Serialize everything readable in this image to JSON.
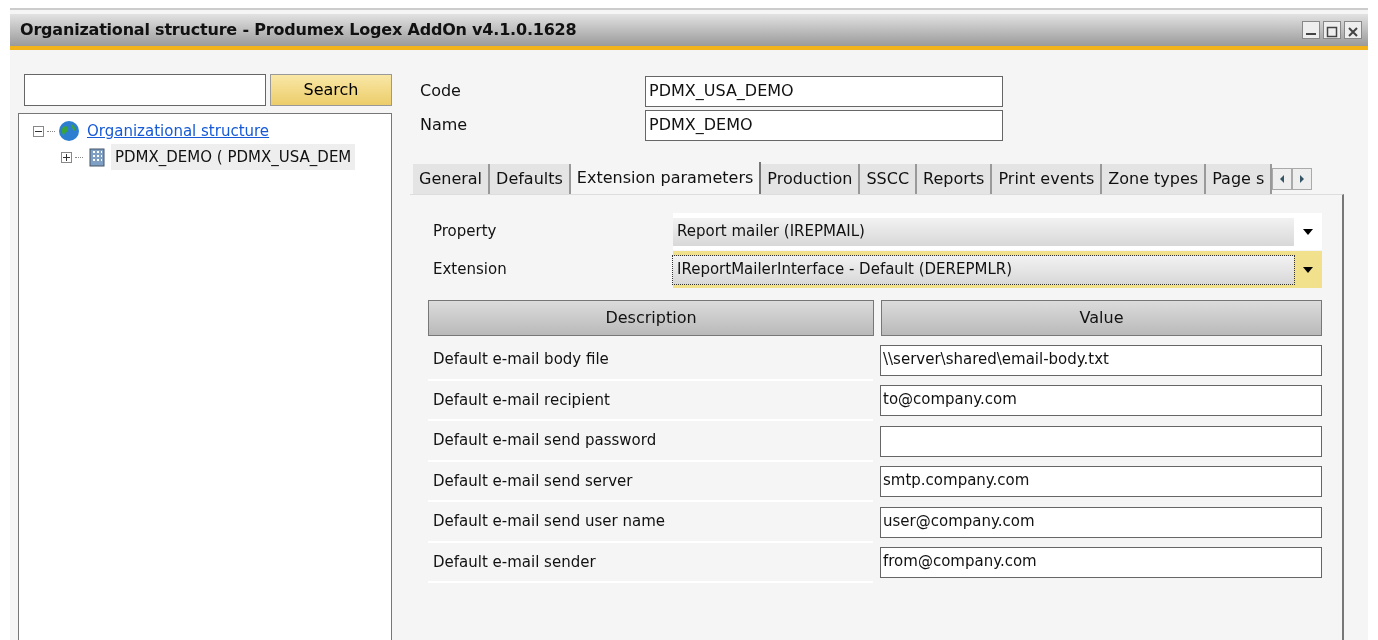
{
  "window": {
    "title": "Organizational structure - Produmex Logex AddOn v4.1.0.1628"
  },
  "search": {
    "button": "Search"
  },
  "tree": [
    {
      "label": "Organizational structure",
      "kind": "root",
      "expanded": true,
      "selected": false,
      "children": [
        {
          "label": "PDMX_DEMO ( PDMX_USA_DEM",
          "kind": "company",
          "expanded": false,
          "selected": true
        }
      ]
    }
  ],
  "header_fields": [
    {
      "label": "Code",
      "value": "PDMX_USA_DEMO"
    },
    {
      "label": "Name",
      "value": "PDMX_DEMO"
    }
  ],
  "tabs": [
    {
      "label": "General",
      "selected": false
    },
    {
      "label": "Defaults",
      "selected": false
    },
    {
      "label": "Extension parameters",
      "selected": true
    },
    {
      "label": "Production",
      "selected": false
    },
    {
      "label": "SSCC",
      "selected": false
    },
    {
      "label": "Reports",
      "selected": false
    },
    {
      "label": "Print events",
      "selected": false
    },
    {
      "label": "Zone types",
      "selected": false
    },
    {
      "label": "Page s",
      "selected": false
    }
  ],
  "combos": [
    {
      "label": "Property",
      "value": "Report mailer (IREPMAIL)",
      "focused": false
    },
    {
      "label": "Extension",
      "value": "IReportMailerInterface - Default (DEREPMLR)",
      "focused": true
    }
  ],
  "table": {
    "columns": [
      "Description",
      "Value"
    ],
    "rows": [
      {
        "description": "Default e-mail body file",
        "value": "\\\\server\\shared\\email-body.txt"
      },
      {
        "description": "Default e-mail recipient",
        "value": "to@company.com"
      },
      {
        "description": "Default e-mail send password"
      },
      {
        "description": "Default e-mail send server",
        "value": "smtp.company.com"
      },
      {
        "description": "Default e-mail send user name",
        "value": "user@company.com"
      },
      {
        "description": "Default e-mail sender",
        "value": "from@company.com"
      }
    ]
  }
}
